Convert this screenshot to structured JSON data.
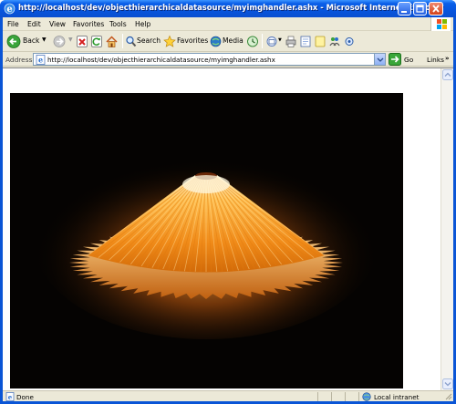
{
  "window": {
    "title": "http://localhost/dev/objecthierarchicaldatasource/myimghandler.ashx - Microsoft Internet Explorer"
  },
  "menu": {
    "items": [
      {
        "label": "File"
      },
      {
        "label": "Edit"
      },
      {
        "label": "View"
      },
      {
        "label": "Favorites"
      },
      {
        "label": "Tools"
      },
      {
        "label": "Help"
      }
    ]
  },
  "toolbar": {
    "back_label": "Back",
    "search_label": "Search",
    "favorites_label": "Favorites",
    "media_label": "Media"
  },
  "address": {
    "label": "Address",
    "url": "http://localhost/dev/objecthierarchicaldatasource/myimghandler.ashx",
    "go_label": "Go",
    "links_label": "Links"
  },
  "status": {
    "text": "Done",
    "zone": "Local intranet"
  },
  "colors": {
    "titlebar": "#0a55d6",
    "chrome": "#ece9d8",
    "lamp_glow": "#ffb040"
  },
  "content": {
    "image_subject": "glowing pleated lamp shade on black background"
  }
}
